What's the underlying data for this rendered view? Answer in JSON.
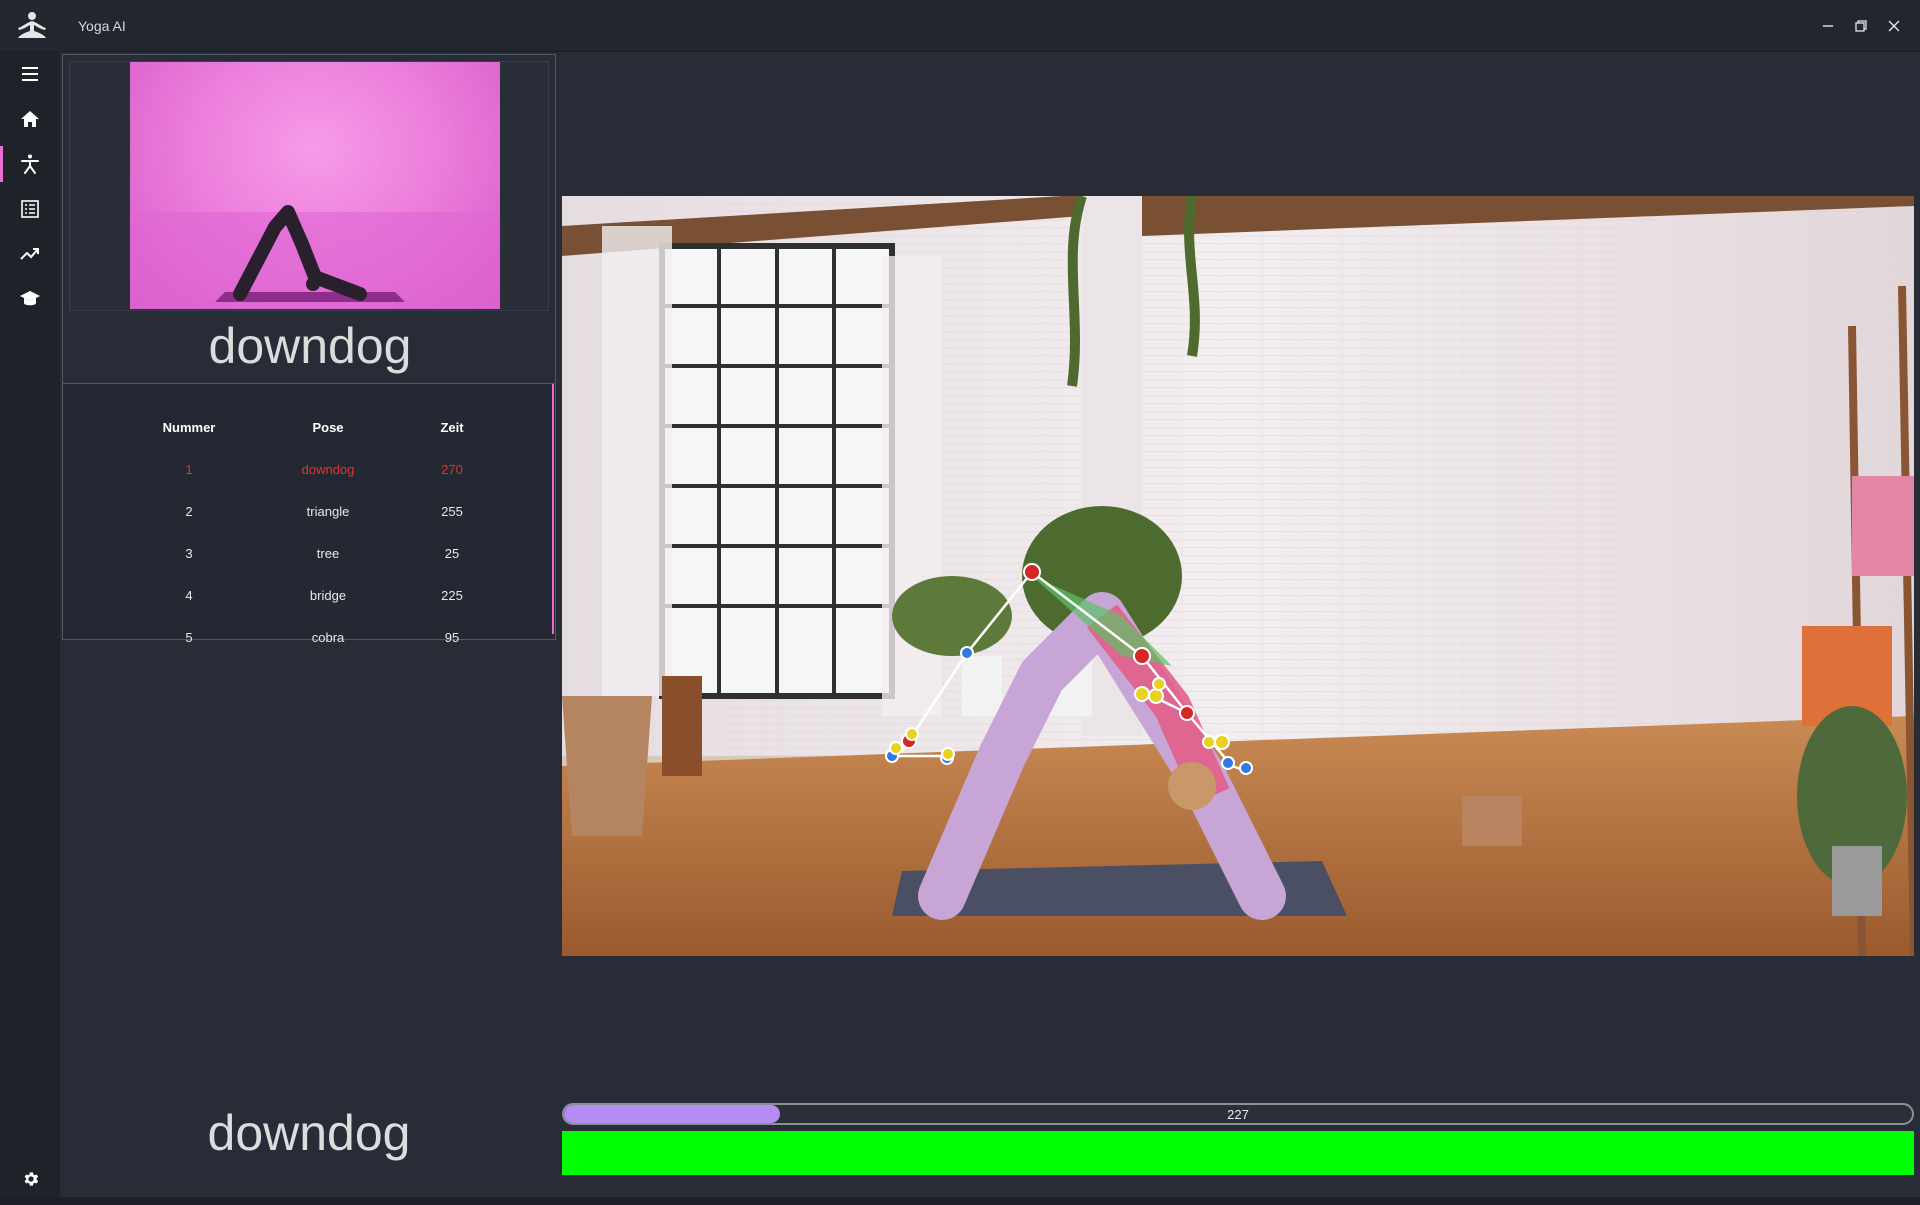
{
  "window": {
    "title": "Yoga AI",
    "minimize_icon": "minimize-icon",
    "restore_icon": "restore-icon",
    "close_icon": "close-icon"
  },
  "sidebar": {
    "items": [
      {
        "icon": "hamburger-menu-icon"
      },
      {
        "icon": "home-icon"
      },
      {
        "icon": "yoga-pose-icon",
        "active": true
      },
      {
        "icon": "list-icon"
      },
      {
        "icon": "trending-up-icon"
      },
      {
        "icon": "graduation-cap-icon"
      }
    ],
    "settings_icon": "gear-icon"
  },
  "preview": {
    "pose_name": "downdog"
  },
  "pose_table": {
    "headers": [
      "Nummer",
      "Pose",
      "Zeit"
    ],
    "rows": [
      {
        "nummer": "1",
        "pose": "downdog",
        "zeit": "270"
      },
      {
        "nummer": "2",
        "pose": "triangle",
        "zeit": "255"
      },
      {
        "nummer": "3",
        "pose": "tree",
        "zeit": "25"
      },
      {
        "nummer": "4",
        "pose": "bridge",
        "zeit": "225"
      },
      {
        "nummer": "5",
        "pose": "cobra",
        "zeit": "95"
      }
    ],
    "current_row_color": "#e0342e"
  },
  "progress": {
    "value_label": "227",
    "fill_fraction": 0.16,
    "fill_color": "#b48cf2"
  },
  "status": {
    "detected_pose": "downdog",
    "indicator_color": "#00ff00"
  },
  "colors": {
    "accent": "#e96ed3",
    "background": "#282c36",
    "titlebar": "#22262e"
  }
}
